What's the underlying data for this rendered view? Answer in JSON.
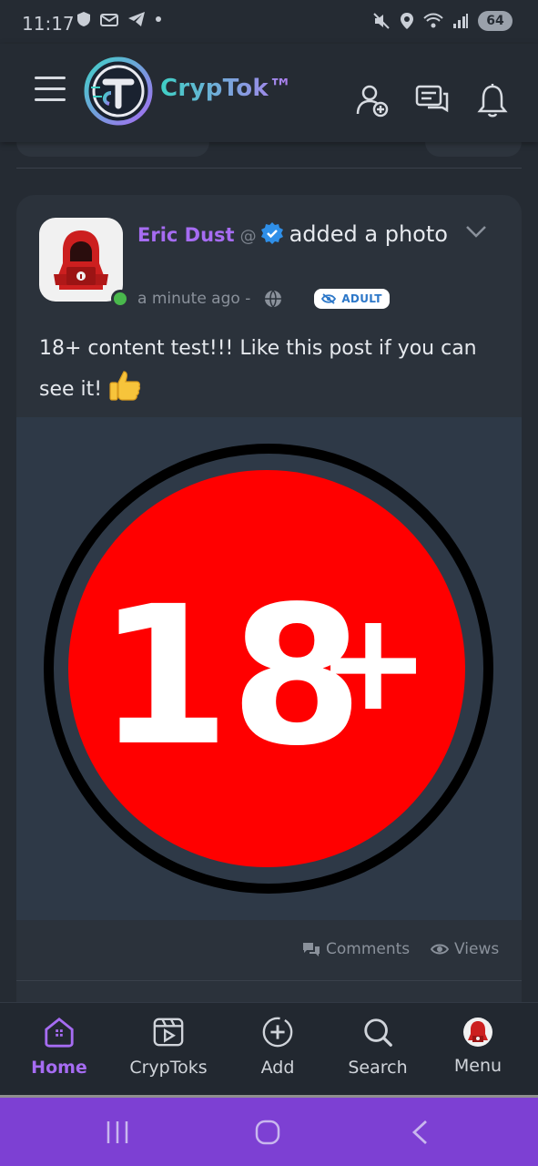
{
  "status_bar": {
    "time": "11:17",
    "battery": "64"
  },
  "header": {
    "brand": "CrypTok™",
    "hamburger_icon": "menu-icon",
    "actions": [
      {
        "icon": "add-user-icon"
      },
      {
        "icon": "messages-icon"
      },
      {
        "icon": "bell-icon"
      }
    ]
  },
  "post": {
    "author": "Eric Dust",
    "at": "@",
    "action": "added a photo",
    "time": "a minute ago -",
    "audience_icon": "globe-icon",
    "badge": "ADULT",
    "text": "18+ content test!!! Like this post if you can see it!",
    "emoji": "thumbs-up",
    "media": {
      "label_main": "18",
      "label_plus": "+"
    },
    "footer": {
      "comments": "Comments",
      "views": "Views"
    }
  },
  "bottom_nav": [
    {
      "label": "Home",
      "icon": "home-icon",
      "active": true
    },
    {
      "label": "CrypToks",
      "icon": "video-icon",
      "active": false
    },
    {
      "label": "Add",
      "icon": "add-icon",
      "active": false
    },
    {
      "label": "Search",
      "icon": "search-icon",
      "active": false
    },
    {
      "label": "Menu",
      "icon": "avatar-icon",
      "active": false
    }
  ],
  "colors": {
    "accent": "#a66cf2",
    "brand_teal": "#3fd1c6",
    "nav_bar": "#7d40d3",
    "adult_red": "#ff0000"
  }
}
